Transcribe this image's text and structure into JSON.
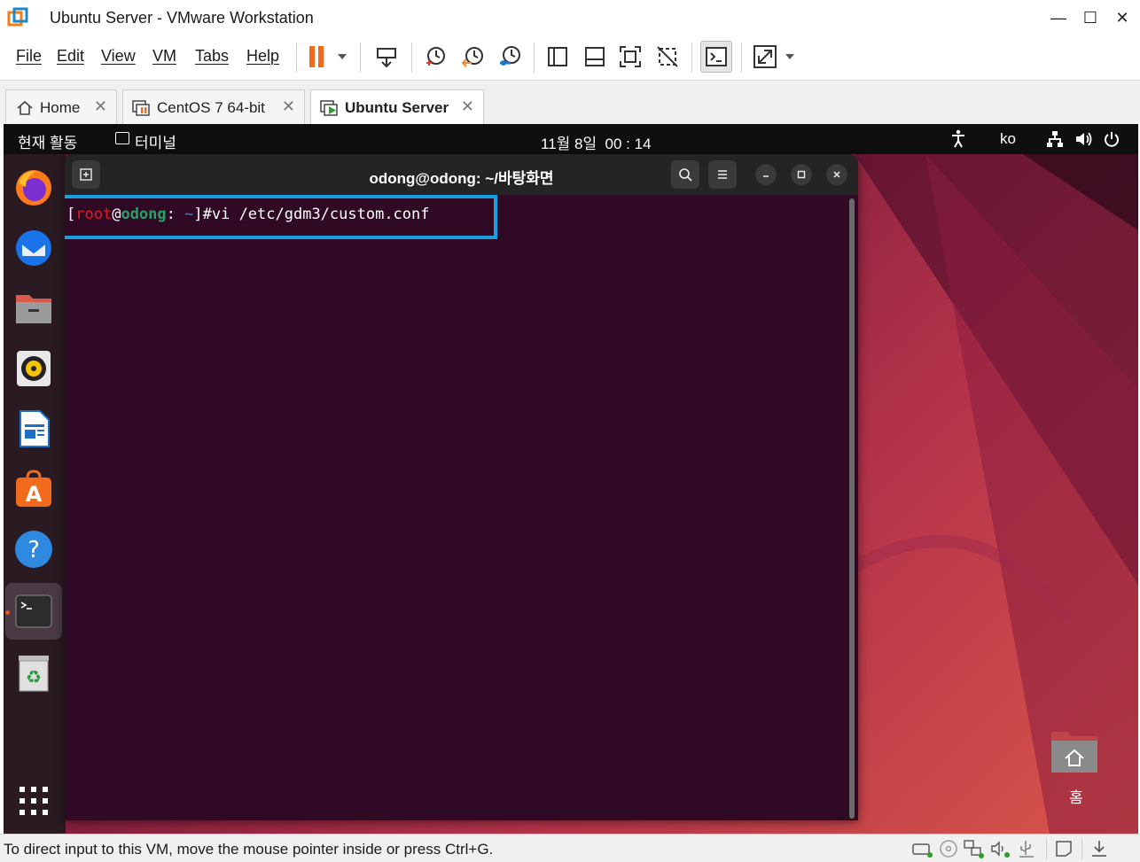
{
  "window": {
    "title": "Ubuntu Server - VMware Workstation",
    "minimize": "—",
    "maximize": "☐",
    "close": "✕"
  },
  "menu": {
    "file": "File",
    "edit": "Edit",
    "view": "View",
    "vm": "VM",
    "tabs": "Tabs",
    "help": "Help"
  },
  "tabs": [
    {
      "label": "Home",
      "close": "✕"
    },
    {
      "label": "CentOS 7 64-bit",
      "close": "✕"
    },
    {
      "label": "Ubuntu Server",
      "close": "✕"
    }
  ],
  "gnome": {
    "activities": "현재 활동",
    "app_name": "터미널",
    "clock": "11월 8일  00 : 14",
    "input_method": "ko"
  },
  "terminal": {
    "title": "odong@odong: ~/바탕화면",
    "prompt_open": "[",
    "user": "root",
    "at": "@",
    "host": "odong",
    "colon": ":",
    "path": " ~",
    "prompt_close": "]#",
    "command": "vi /etc/gdm3/custom.conf"
  },
  "desktop": {
    "home_label": "홈"
  },
  "statusbar": {
    "text": "To direct input to this VM, move the mouse pointer inside or press Ctrl+G."
  },
  "colors": {
    "accent_highlight": "#1aa0e0",
    "terminal_bg": "#300a24",
    "prompt_user": "#e01b24",
    "prompt_host": "#26a269",
    "prompt_path": "#3584e4",
    "pause_orange": "#f26b1d"
  }
}
